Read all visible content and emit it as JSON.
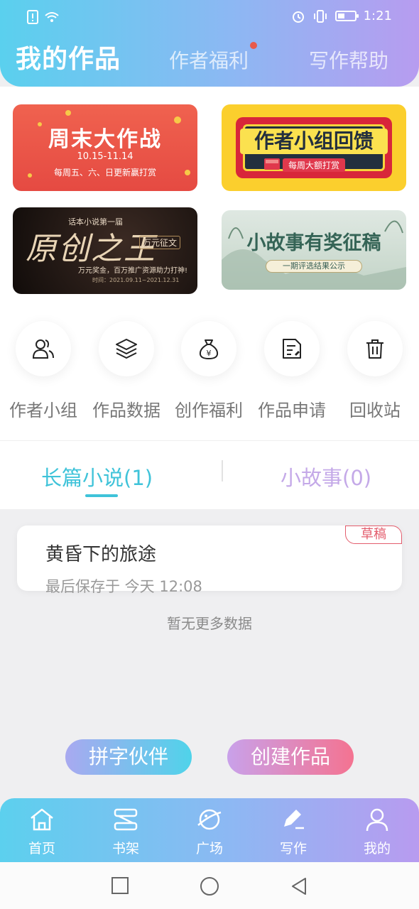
{
  "status": {
    "time": "1:21",
    "battery_level": 0.35
  },
  "header": {
    "title": "我的作品",
    "tabs": [
      {
        "label": "作者福利",
        "has_dot": true
      },
      {
        "label": "写作帮助"
      }
    ]
  },
  "banners": [
    {
      "title": "周末大作战",
      "date": "10.15-11.14",
      "subtitle": "每周五、六、日更新赢打赏"
    },
    {
      "title": "作者小组回馈",
      "subtitle": "每周大额打赏"
    },
    {
      "top": "话本小说第一届",
      "title": "原创之王",
      "tag": "万元征文",
      "subtitle": "万元奖金，百万推广资源助力打神!",
      "time": "时间：2021.09.11~2021.12.31"
    },
    {
      "title": "小故事有奖征稿",
      "subtitle": "一期评选结果公示"
    }
  ],
  "shortcuts": [
    {
      "label": "作者小组",
      "icon": "people-icon"
    },
    {
      "label": "作品数据",
      "icon": "layers-icon"
    },
    {
      "label": "创作福利",
      "icon": "money-bag-icon"
    },
    {
      "label": "作品申请",
      "icon": "document-icon"
    },
    {
      "label": "回收站",
      "icon": "trash-icon"
    }
  ],
  "work_tabs": [
    {
      "label": "长篇小说(1)",
      "active": true
    },
    {
      "label": "小故事(0)",
      "active": false
    }
  ],
  "works": [
    {
      "title": "黄昏下的旅途",
      "saved": "最后保存于 今天 12:08",
      "badge": "草稿"
    }
  ],
  "no_more": "暂无更多数据",
  "actions": {
    "partner": "拼字伙伴",
    "create": "创建作品"
  },
  "bottom_nav": [
    {
      "label": "首页",
      "icon": "home-icon"
    },
    {
      "label": "书架",
      "icon": "bookshelf-icon"
    },
    {
      "label": "广场",
      "icon": "planet-icon"
    },
    {
      "label": "写作",
      "icon": "pen-icon",
      "active": true
    },
    {
      "label": "我的",
      "icon": "user-icon"
    }
  ],
  "colors": {
    "accent": "#3fc3d9",
    "draft": "#e35d6d",
    "header_start": "#5ad0ee",
    "header_end": "#b79cf0"
  }
}
